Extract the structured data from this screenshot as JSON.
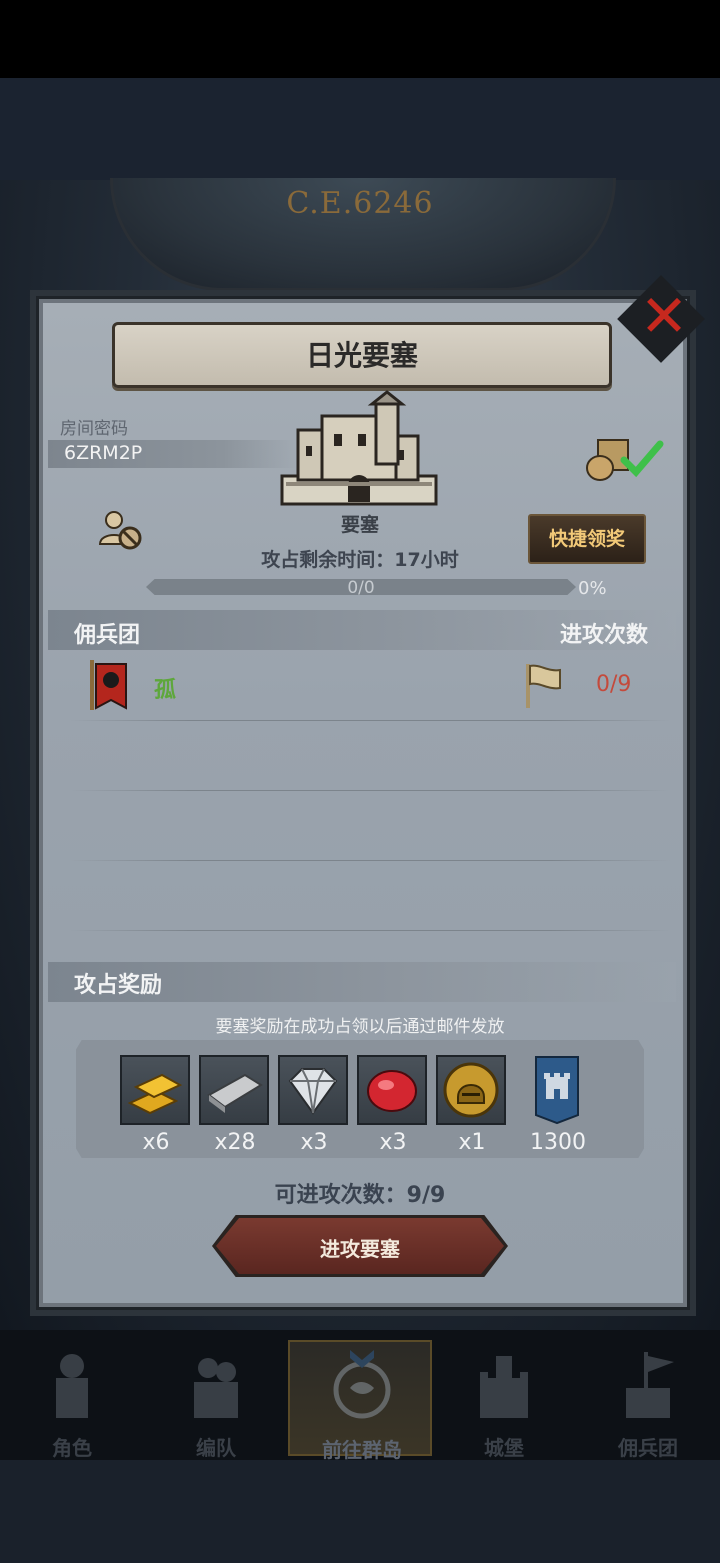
{
  "header": {
    "era_label": "C.E.6246"
  },
  "dialog": {
    "title": "日光要塞",
    "close_icon": "close-x-icon",
    "room_code_label": "房间密码",
    "room_code": "6ZRM2P",
    "fortress_label": "要塞",
    "quick_claim_label": "快捷领奖",
    "remaining_time": "攻占剩余时间：17小时",
    "progress_text": "0/0",
    "progress_percent": "0%",
    "progress_fraction": 0
  },
  "mercenary": {
    "heading": "佣兵团",
    "attacks_heading": "进攻次数",
    "members": [
      {
        "name": "孤",
        "attacks": "0/9"
      }
    ]
  },
  "rewards": {
    "heading": "攻占奖励",
    "note": "要塞奖励在成功占领以后通过邮件发放",
    "items": [
      {
        "icon": "gold-bars-icon",
        "count": "x6"
      },
      {
        "icon": "iron-ingot-icon",
        "count": "x28"
      },
      {
        "icon": "diamond-icon",
        "count": "x3"
      },
      {
        "icon": "ruby-icon",
        "count": "x3"
      },
      {
        "icon": "helmet-coin-icon",
        "count": "x1"
      },
      {
        "icon": "castle-token-icon",
        "count": "1300"
      }
    ]
  },
  "available_attacks": "可进攻次数：9/9",
  "attack_button": "进攻要塞",
  "nav": [
    {
      "label": "角色",
      "icon": "knight-icon"
    },
    {
      "label": "编队",
      "icon": "squad-icon"
    },
    {
      "label": "前往群岛",
      "icon": "islands-icon",
      "active": true
    },
    {
      "label": "城堡",
      "icon": "castle-icon"
    },
    {
      "label": "佣兵团",
      "icon": "mercenary-icon"
    }
  ],
  "colors": {
    "panel": "#9aa3ad",
    "accent_gold": "#f2c978",
    "member_green": "#5ea73c",
    "attack_red": "#c44a3c",
    "button_red": "#6a3028"
  }
}
